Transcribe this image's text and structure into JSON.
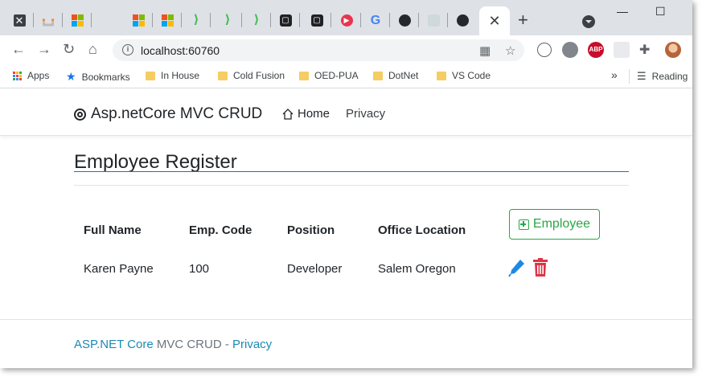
{
  "browser": {
    "tabs": [
      {
        "icon": "close-x-favicon"
      },
      {
        "icon": "stackoverflow-favicon"
      },
      {
        "icon": "microsoft-favicon"
      },
      {
        "icon": "microsoft-favicon"
      },
      {
        "icon": "microsoft-favicon"
      },
      {
        "icon": "green-arrow-favicon"
      },
      {
        "icon": "green-arrow-favicon"
      },
      {
        "icon": "green-arrow-favicon"
      },
      {
        "icon": "dark-app-favicon"
      },
      {
        "icon": "dark-app-favicon"
      },
      {
        "icon": "red-play-favicon"
      },
      {
        "icon": "google-favicon"
      },
      {
        "icon": "github-favicon"
      },
      {
        "icon": "light-app-favicon"
      },
      {
        "icon": "github-favicon"
      }
    ],
    "active_tab_close": "✕",
    "new_tab": "+",
    "address": "localhost:60760",
    "bookmarks": [
      {
        "label": "Apps",
        "icon": "apps-icon"
      },
      {
        "label": "Bookmarks",
        "icon": "star-icon"
      },
      {
        "label": "In House",
        "icon": "folder-icon"
      },
      {
        "label": "Cold Fusion",
        "icon": "folder-icon"
      },
      {
        "label": "OED-PUA",
        "icon": "folder-icon"
      },
      {
        "label": "DotNet",
        "icon": "folder-icon"
      },
      {
        "label": "VS Code",
        "icon": "folder-icon"
      }
    ],
    "more_bookmarks": "»",
    "reading_list": "Reading",
    "extension_abp": "ABP"
  },
  "site": {
    "brand": "Asp.netCore MVC CRUD",
    "nav": {
      "home": "Home",
      "privacy": "Privacy"
    }
  },
  "main": {
    "title": "Employee Register",
    "add_button": "Employee",
    "columns": [
      "Full Name",
      "Emp. Code",
      "Position",
      "Office Location"
    ],
    "rows": [
      {
        "full_name": "Karen Payne",
        "emp_code": "100",
        "position": "Developer",
        "office_location": "Salem Oregon"
      }
    ]
  },
  "footer": {
    "link1": "ASP.NET Core",
    "middle": " MVC CRUD - ",
    "link2": "Privacy"
  },
  "colors": {
    "success": "#28a745",
    "edit": "#1e88e5",
    "delete": "#dc3545",
    "link": "#1b8ab4",
    "title_underline": "#2a6fa8"
  }
}
